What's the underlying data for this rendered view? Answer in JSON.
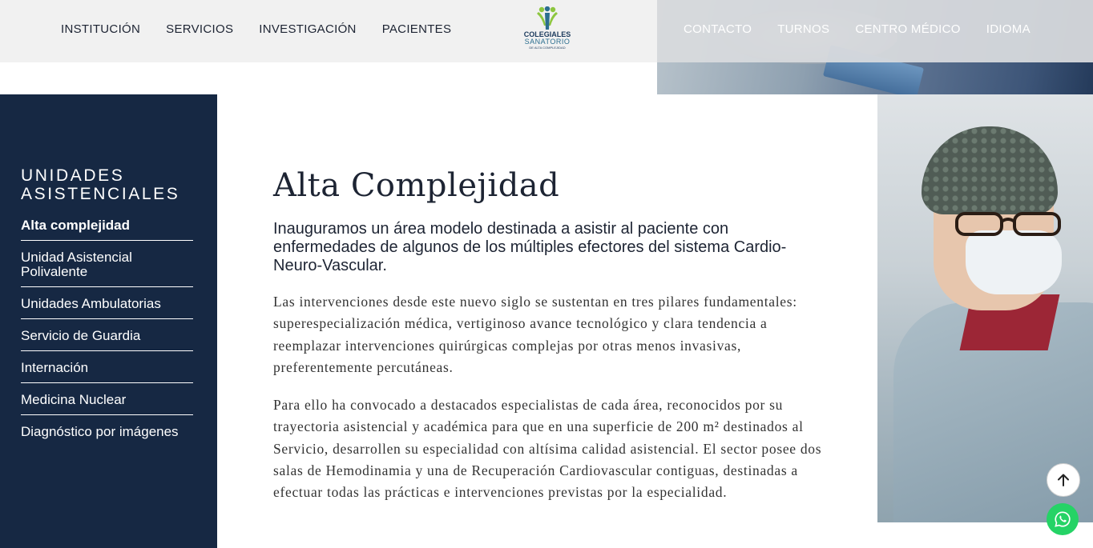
{
  "header": {
    "nav_left": [
      "INSTITUCIÓN",
      "SERVICIOS",
      "INVESTIGACIÓN",
      "PACIENTES"
    ],
    "nav_right": [
      "CONTACTO",
      "TURNOS",
      "CENTRO MÉDICO",
      "IDIOMA"
    ],
    "logo": {
      "line1": "COLEGIALES",
      "line2": "SANATORIO",
      "line3": "DE ALTA COMPLEJIDAD"
    },
    "colors": {
      "logo_blue": "#1b3a5c",
      "logo_teal": "#2b6e8f",
      "logo_green": "#8dc63f"
    }
  },
  "sidebar": {
    "title": "UNIDADES ASISTENCIALES",
    "items": [
      {
        "label": "Alta complejidad",
        "active": true
      },
      {
        "label": "Unidad Asistencial Polivalente"
      },
      {
        "label": "Unidades Ambulatorias"
      },
      {
        "label": "Servicio de Guardia"
      },
      {
        "label": "Internación"
      },
      {
        "label": "Medicina Nuclear"
      },
      {
        "label": "Diagnóstico por imágenes"
      }
    ],
    "background": "#162843"
  },
  "main": {
    "title": "Alta Complejidad",
    "lead": "Inauguramos un área modelo destinada a asistir al paciente con enfermedades de algunos de los múltiples efectores del sistema Cardio-Neuro-Vascular.",
    "paragraphs": [
      "Las intervenciones desde este nuevo siglo se sustentan en tres pilares fundamentales: superespecialización médica, vertiginoso avance tecnológico y clara tendencia a reemplazar intervenciones quirúrgicas complejas por otras menos invasivas, preferentemente percutáneas.",
      "Para ello ha convocado a destacados especialistas de cada área, reconocidos por su trayectoria asistencial y académica para que en una superficie de 200 m² destinados al Servicio, desarrollen su especialidad con altísima calidad asistencial. El sector posee dos salas de Hemodinamia y una de Recuperación Cardiovascular contiguas, destinadas a efectuar todas las prácticas e intervenciones previstas por la especialidad."
    ]
  },
  "floating": {
    "scroll_top_icon": "arrow-up-icon",
    "whatsapp_icon": "whatsapp-icon",
    "whatsapp_color": "#25d366"
  }
}
